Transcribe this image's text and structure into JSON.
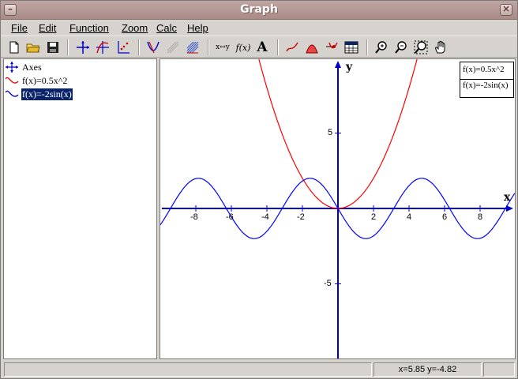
{
  "window": {
    "title": "Graph"
  },
  "menu": [
    {
      "key": "file",
      "label": "File"
    },
    {
      "key": "edit",
      "label": "Edit"
    },
    {
      "key": "function",
      "label": "Function"
    },
    {
      "key": "zoom",
      "label": "Zoom"
    },
    {
      "key": "calc",
      "label": "Calc"
    },
    {
      "key": "help",
      "label": "Help"
    }
  ],
  "toolbar": {
    "buttons": [
      {
        "name": "new-file-icon"
      },
      {
        "name": "open-folder-icon"
      },
      {
        "name": "save-disk-icon"
      },
      {
        "name": "axes-icon"
      },
      {
        "name": "insert-function-icon"
      },
      {
        "name": "insert-point-series-icon"
      },
      {
        "name": "tangent-icon"
      },
      {
        "name": "shade-icon"
      },
      {
        "name": "hatch-icon"
      },
      {
        "name": "swap-xy-icon",
        "text": "x↔y"
      },
      {
        "name": "evaluate-function-icon",
        "text": "f(x)"
      },
      {
        "name": "insert-label-icon",
        "text": "A"
      },
      {
        "name": "trendline-icon"
      },
      {
        "name": "area-icon"
      },
      {
        "name": "animate-icon"
      },
      {
        "name": "table-icon"
      },
      {
        "name": "zoom-in-icon"
      },
      {
        "name": "zoom-out-icon"
      },
      {
        "name": "zoom-fit-icon"
      },
      {
        "name": "pan-hand-icon"
      }
    ]
  },
  "tree": {
    "items": [
      {
        "label": "Axes",
        "icon": "axes-icon",
        "selected": false
      },
      {
        "label": "f(x)=0.5x^2",
        "icon": "red-curve-icon",
        "selected": false
      },
      {
        "label": "f(x)=-2sin(x)",
        "icon": "blue-wave-icon",
        "selected": true
      }
    ]
  },
  "legend": {
    "entries": [
      "f(x)=0.5x^2",
      "f(x)=-2sin(x)"
    ]
  },
  "chart_data": {
    "type": "line",
    "xlabel": "x",
    "ylabel": "y",
    "xlim": [
      -9.8,
      9.8
    ],
    "ylim": [
      -8.2,
      8.2
    ],
    "x_ticks": [
      -8,
      -6,
      -4,
      -2,
      2,
      4,
      6,
      8
    ],
    "y_ticks": [
      5,
      -5
    ],
    "series": [
      {
        "name": "f(x)=0.5x^2",
        "color": "#ff0000",
        "expression": "0.5*x^2"
      },
      {
        "name": "f(x)=-2sin(x)",
        "color": "#0000ff",
        "expression": "-2*sin(x)"
      }
    ],
    "axis_color": "#0000cc"
  },
  "status": {
    "main": "",
    "coords": "x=5.85  y=-4.82",
    "extra": ""
  }
}
